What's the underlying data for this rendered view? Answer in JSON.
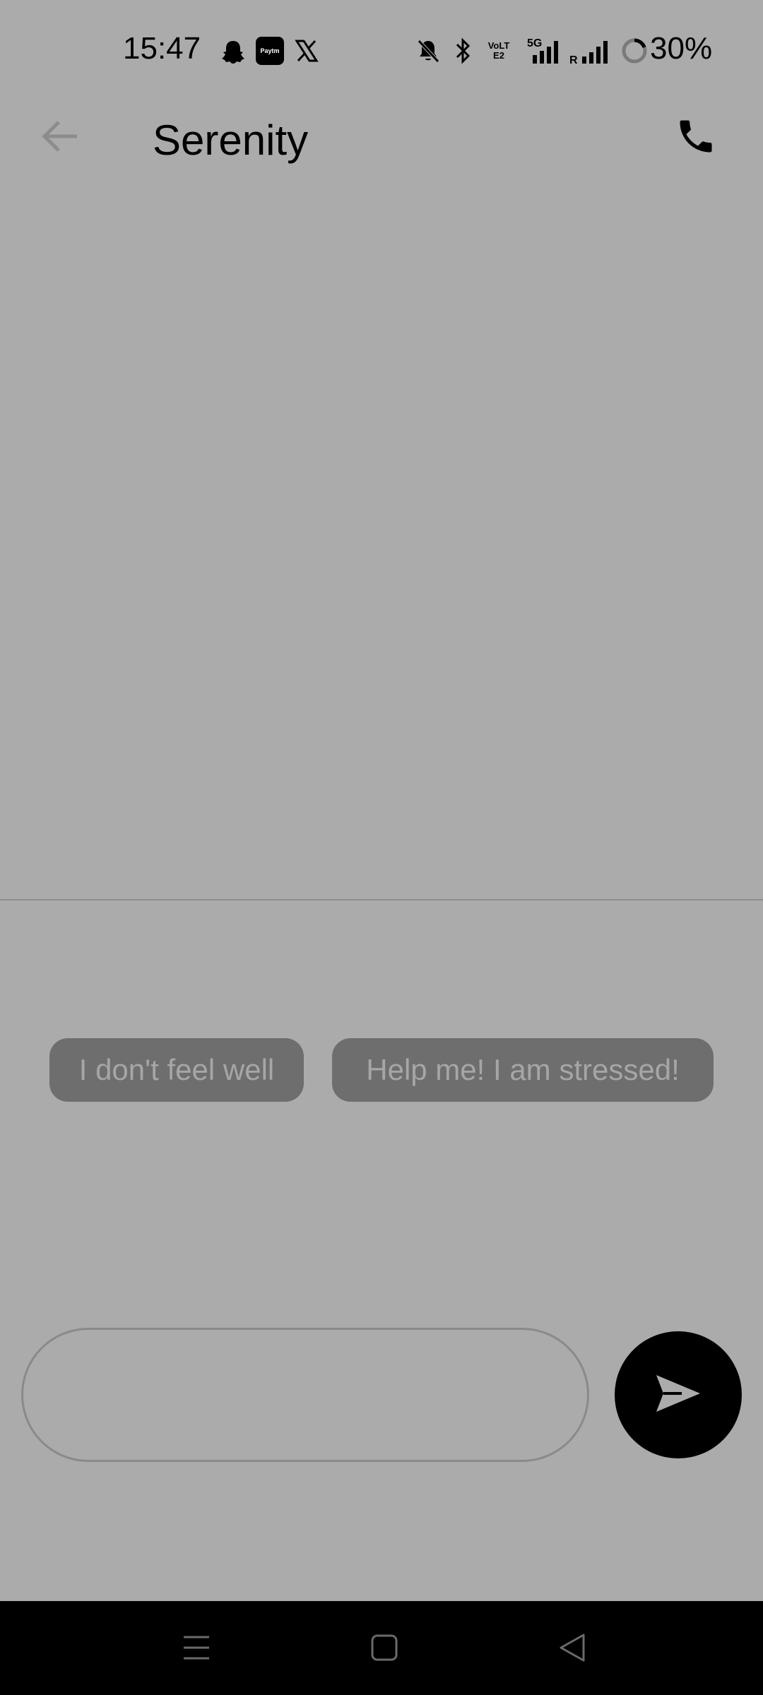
{
  "status_bar": {
    "time": "15:47",
    "battery": "30%",
    "icons": [
      "snapchat-icon",
      "paytm-icon",
      "x-icon",
      "bell-off-icon",
      "bluetooth-icon",
      "volte-icon",
      "signal-5g-icon",
      "signal-roaming-icon",
      "battery-icon"
    ],
    "paytm_label": "Paytm",
    "volte_label": "VoLTE2",
    "fiveg_label": "5G",
    "roaming_label": "R"
  },
  "app_bar": {
    "title": "Serenity",
    "back_icon": "arrow-left-icon",
    "call_icon": "phone-icon"
  },
  "suggestions": [
    {
      "label": "I don't feel well"
    },
    {
      "label": "Help me! I am stressed!"
    }
  ],
  "composer": {
    "value": "",
    "send_icon": "send-icon"
  },
  "nav_bar": {
    "icons": [
      "menu-icon",
      "home-icon",
      "back-triangle-icon"
    ]
  },
  "colors": {
    "background": "#ababab",
    "chip_bg": "#6e6e6e",
    "chip_text": "#a6a6a6",
    "send_button": "#000000",
    "nav_bar": "#000000"
  }
}
